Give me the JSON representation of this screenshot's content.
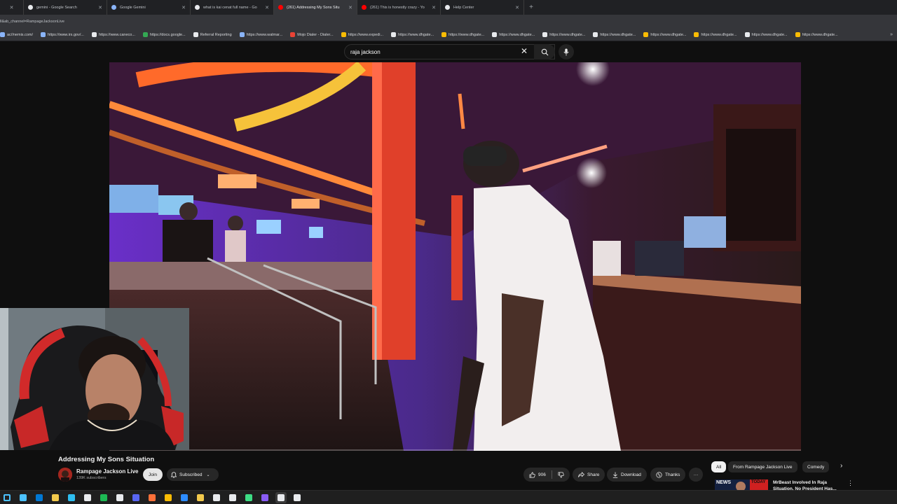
{
  "browser": {
    "tabs": [
      {
        "title": "",
        "active": false,
        "favicon": "none",
        "color": "#9aa0a6"
      },
      {
        "title": "gemini - Google Search",
        "active": false,
        "favicon": "google-icon",
        "color": "#e8eaed"
      },
      {
        "title": "Google Gemini",
        "active": false,
        "favicon": "gemini-icon",
        "color": "#8ab4f8"
      },
      {
        "title": "what is kai cenat full name - Go",
        "active": false,
        "favicon": "google-icon",
        "color": "#e8eaed"
      },
      {
        "title": "(261) Addressing My Sons Situ",
        "active": true,
        "favicon": "youtube-icon",
        "color": "#ff0000"
      },
      {
        "title": "(261) This is honestly crazy - Yo",
        "active": false,
        "favicon": "youtube-icon",
        "color": "#ff0000"
      },
      {
        "title": "Help Center",
        "active": false,
        "favicon": "x-icon",
        "color": "#e8eaed"
      }
    ],
    "url": "ll&ab_channel=RampageJacksonLive",
    "bookmarks": [
      {
        "label": "ac//nemis.com/",
        "color": "#8ab4f8"
      },
      {
        "label": "https://www.irs.gov/...",
        "color": "#8ab4f8"
      },
      {
        "label": "https://www.caneco...",
        "color": "#e8eaed"
      },
      {
        "label": "https://docs.google...",
        "color": "#34a853"
      },
      {
        "label": "Referral Reporting",
        "color": "#e8eaed"
      },
      {
        "label": "https://www.walmar...",
        "color": "#8ab4f8"
      },
      {
        "label": "Mojo Dialer - Dialer...",
        "color": "#ea4335"
      },
      {
        "label": "https://www.expedi...",
        "color": "#fbbc04"
      },
      {
        "label": "https://www.dhgate...",
        "color": "#e8eaed"
      },
      {
        "label": "https://www.dhgate...",
        "color": "#fbbc04"
      },
      {
        "label": "https://www.dhgate...",
        "color": "#e8eaed"
      },
      {
        "label": "https://www.dhgate...",
        "color": "#e8eaed"
      },
      {
        "label": "https://www.dhgate...",
        "color": "#e8eaed"
      },
      {
        "label": "https://www.dhgate...",
        "color": "#fbbc04"
      },
      {
        "label": "https://www.dhgate...",
        "color": "#fbbc04"
      },
      {
        "label": "https://www.dhgate...",
        "color": "#e8eaed"
      },
      {
        "label": "https://www.dhgate...",
        "color": "#fbbc04"
      }
    ],
    "bookmarks_more": "»"
  },
  "youtube": {
    "search_query": "raja jackson",
    "video": {
      "title": "Addressing My Sons Situation",
      "channel": "Rampage Jackson Live",
      "subscribers": "139K subscribers",
      "join_label": "Join",
      "subscribed_label": "Subscribed",
      "likes": "906",
      "share_label": "Share",
      "download_label": "Download",
      "thanks_label": "Thanks",
      "more_label": "···"
    },
    "chips": [
      {
        "label": "All",
        "active": true
      },
      {
        "label": "From Rampage Jackson Live",
        "active": false
      },
      {
        "label": "Comedy",
        "active": false
      }
    ],
    "recommended": {
      "title": "MrBeast Involved In Raja Situation, No President Has...",
      "thumb_text": "NEWS",
      "thumb_text2": "TODAY"
    }
  },
  "taskbar": {
    "icons": [
      {
        "name": "windows-start-icon",
        "color": "#4cc2ff"
      },
      {
        "name": "calendar-icon",
        "color": "#4cc2ff"
      },
      {
        "name": "outlook-icon",
        "color": "#0078d4"
      },
      {
        "name": "file-explorer-icon",
        "color": "#f2c94c"
      },
      {
        "name": "edge-icon",
        "color": "#2ebef0"
      },
      {
        "name": "xbox-icon",
        "color": "#e8eaed"
      },
      {
        "name": "spotify-icon",
        "color": "#1db954"
      },
      {
        "name": "photos-icon",
        "color": "#e8eaed"
      },
      {
        "name": "discord-icon",
        "color": "#5865f2"
      },
      {
        "name": "firefox-icon",
        "color": "#ff7139"
      },
      {
        "name": "chrome-icon",
        "color": "#fbbc04"
      },
      {
        "name": "zoom-icon",
        "color": "#2d8cff"
      },
      {
        "name": "app-icon",
        "color": "#f2c94c"
      },
      {
        "name": "app-icon",
        "color": "#e8eaed"
      },
      {
        "name": "app-icon",
        "color": "#e8eaed"
      },
      {
        "name": "app-icon",
        "color": "#3ddc84"
      },
      {
        "name": "app-icon",
        "color": "#8a5cf6"
      },
      {
        "name": "obs-icon",
        "color": "#e8eaed"
      },
      {
        "name": "app-icon",
        "color": "#e8eaed"
      }
    ]
  }
}
